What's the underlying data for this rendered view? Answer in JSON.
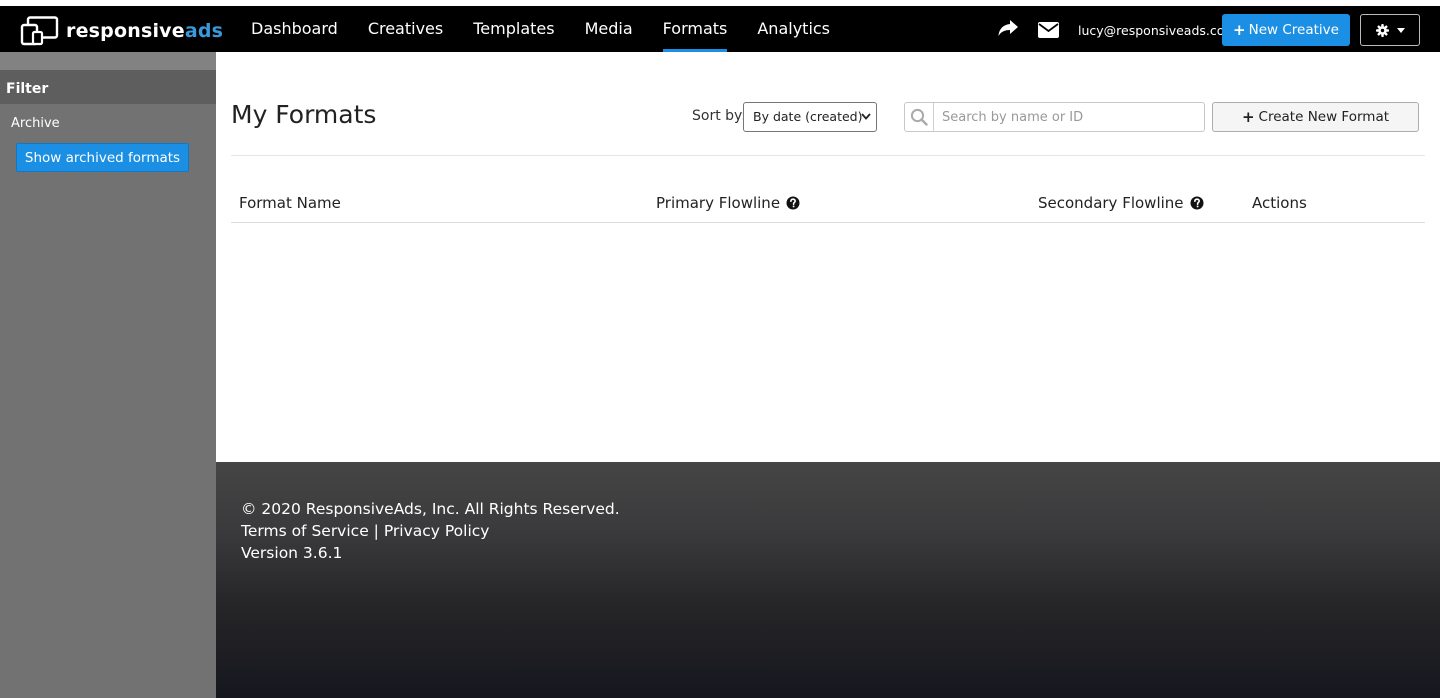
{
  "brand": {
    "name_white": "responsive",
    "name_blue": "ads",
    "accent": "#3a9ad9"
  },
  "nav": {
    "items": [
      {
        "label": "Dashboard",
        "active": false
      },
      {
        "label": "Creatives",
        "active": false
      },
      {
        "label": "Templates",
        "active": false
      },
      {
        "label": "Media",
        "active": false
      },
      {
        "label": "Formats",
        "active": true
      },
      {
        "label": "Analytics",
        "active": false
      }
    ],
    "share_icon": "share-icon",
    "mail_icon": "envelope-icon",
    "user_email": "lucy@responsiveads.com",
    "new_creative_label": "New Creative",
    "settings_icon": "gear-icon",
    "primary_color": "#1a8fe3"
  },
  "sidebar": {
    "title": "Filter",
    "archive_label": "Archive",
    "show_archived_label": "Show archived formats"
  },
  "main": {
    "title": "My Formats",
    "sort_label": "Sort by:",
    "sort_selected": "By date (created)",
    "search_placeholder": "Search by name or ID",
    "search_value": "",
    "create_label": "Create New Format",
    "table": {
      "columns": [
        "Format Name",
        "Primary Flowline",
        "Secondary Flowline",
        "Actions"
      ],
      "rows": []
    }
  },
  "footer": {
    "copyright": "© 2020 ResponsiveAds, Inc. All Rights Reserved.",
    "terms": "Terms of Service",
    "separator": "|",
    "privacy": "Privacy Policy",
    "version": "Version 3.6.1"
  }
}
